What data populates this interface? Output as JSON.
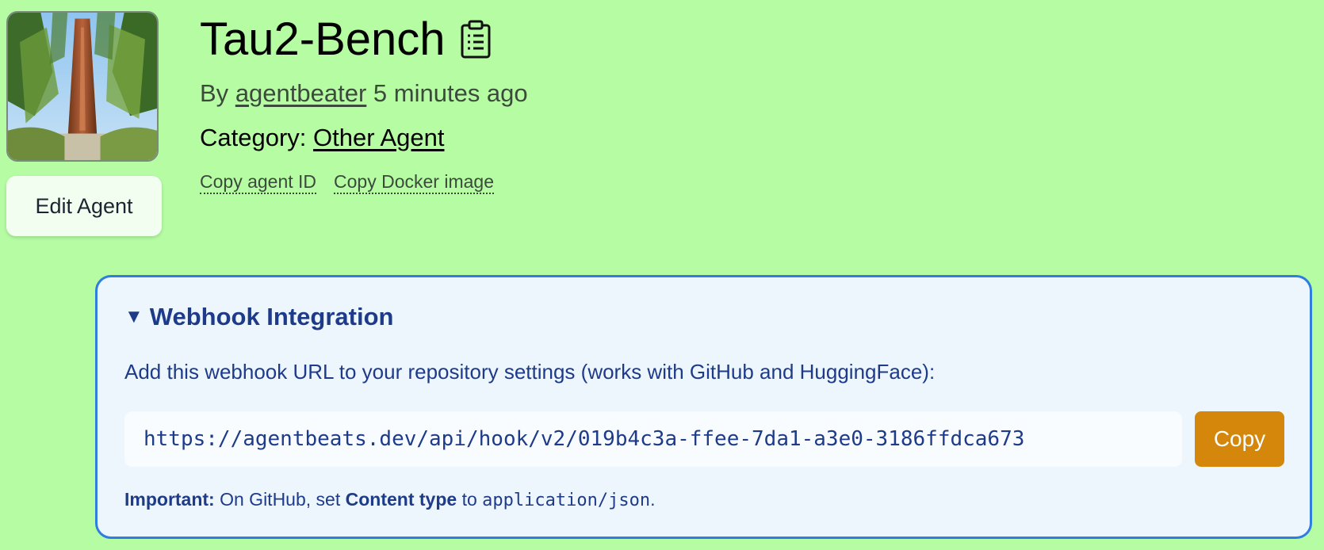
{
  "agent": {
    "title": "Tau2-Bench",
    "by_prefix": "By",
    "author": "agentbeater",
    "time_ago": "5 minutes ago",
    "category_label": "Category:",
    "category": "Other Agent",
    "edit_label": "Edit Agent",
    "copy_id_label": "Copy agent ID",
    "copy_docker_label": "Copy Docker image"
  },
  "icons": {
    "title_icon": "clipboard-icon",
    "avatar": "redwood-tree-photo",
    "summary_marker": "caret-down-icon"
  },
  "webhook": {
    "summary": "Webhook Integration",
    "caret": "▼",
    "description": "Add this webhook URL to your repository settings (works with GitHub and HuggingFace):",
    "url": "https://agentbeats.dev/api/hook/v2/019b4c3a-ffee-7da1-a3e0-3186ffdca673",
    "copy_label": "Copy",
    "important_label": "Important:",
    "important_text_1": "On GitHub, set",
    "important_bold": "Content type",
    "important_text_2": "to",
    "important_code": "application/json",
    "important_end": "."
  },
  "colors": {
    "page_bg": "#b5fca3",
    "panel_bg": "#eef6fd",
    "panel_border": "#2f7de1",
    "accent_text": "#1e3b8a",
    "copy_button": "#d4870b"
  }
}
